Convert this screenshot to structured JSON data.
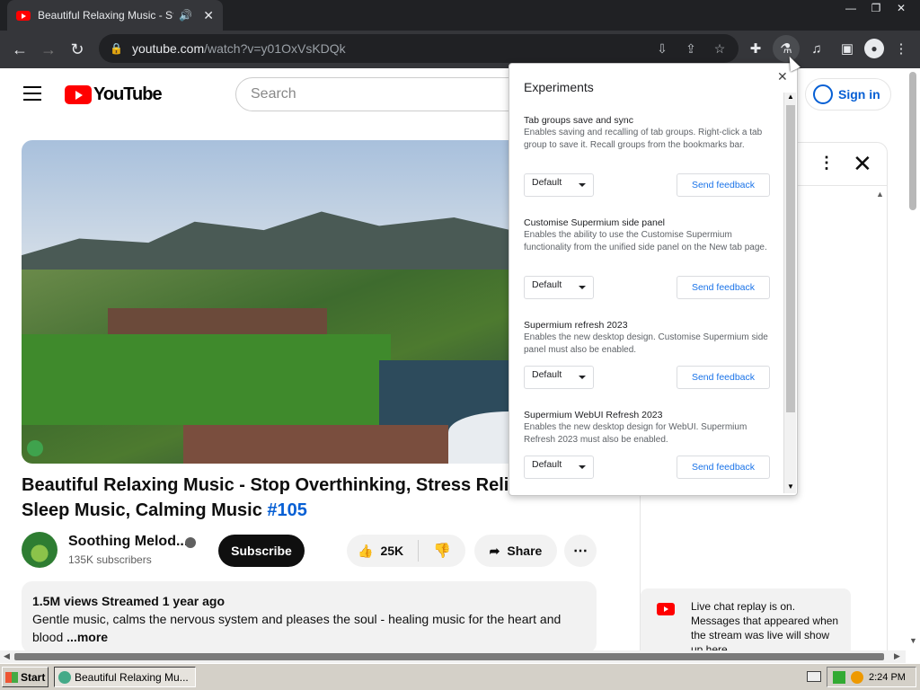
{
  "browser": {
    "tab_title": "Beautiful Relaxing Music - Stop",
    "tab_audio_icon": "speaker-icon",
    "url_host": "youtube.com",
    "url_path": "/watch?v=y01OxVsKDQk",
    "win_minimize": "—",
    "win_restore": "❐",
    "win_close": "✕"
  },
  "youtube": {
    "logo_text": "YouTube",
    "search_placeholder": "Search",
    "sign_in_label": "Sign in",
    "video_title": "Beautiful Relaxing Music - Stop Overthinking, Stress Relief Music, Sleep Music, Calming Music",
    "video_hashtag": "#105",
    "channel_name": "Soothing Melod...",
    "subscribers": "135K subscribers",
    "subscribe_label": "Subscribe",
    "like_count": "25K",
    "share_label": "Share",
    "views": "1.5M views",
    "streamed": "Streamed 1 year ago",
    "description": "Gentle music, calms the nervous system and pleases the soul - healing music for the heart and blood",
    "more_label": "...more",
    "chat_replay_text": "Live chat replay is on. Messages that appeared when the stream was live will show up here."
  },
  "experiments": {
    "title": "Experiments",
    "items": [
      {
        "name": "Tab groups save and sync",
        "description": "Enables saving and recalling of tab groups. Right-click a tab group to save it. Recall groups from the bookmarks bar.",
        "select_value": "Default",
        "feedback_label": "Send feedback"
      },
      {
        "name": "Customise Supermium side panel",
        "description": "Enables the ability to use the Customise Supermium functionality from the unified side panel on the New tab page.",
        "select_value": "Default",
        "feedback_label": "Send feedback"
      },
      {
        "name": "Supermium refresh 2023",
        "description": "Enables the new desktop design. Customise Supermium side panel must also be enabled.",
        "select_value": "Default",
        "feedback_label": "Send feedback"
      },
      {
        "name": "Supermium WebUI Refresh 2023",
        "description": "Enables the new desktop design for WebUI. Supermium Refresh 2023 must also be enabled.",
        "select_value": "Default",
        "feedback_label": "Send feedback"
      }
    ]
  },
  "taskbar": {
    "start_label": "Start",
    "task_label": "Beautiful Relaxing Mu...",
    "clock": "2:24 PM"
  }
}
